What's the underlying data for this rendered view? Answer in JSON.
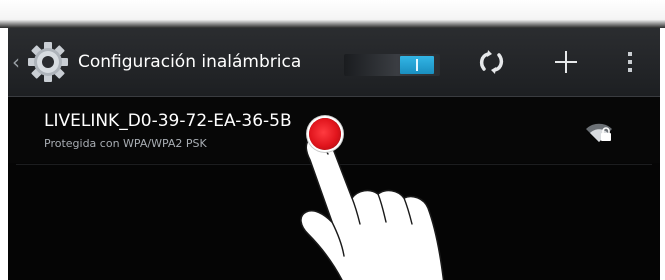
{
  "action_bar": {
    "title": "Configuración inalámbrica",
    "up_icon": "chevron-left-icon",
    "app_icon": "settings-gear-icon",
    "wifi_toggle": {
      "state": "on",
      "accent": "#33b5e5"
    },
    "actions": [
      {
        "name": "wps-icon"
      },
      {
        "name": "add-network-icon"
      },
      {
        "name": "overflow-menu-icon"
      }
    ]
  },
  "networks": [
    {
      "ssid": "LIVELINK_D0-39-72-EA-36-5B",
      "security": "Protegida con WPA/WPA2 PSK",
      "signal_icon": "wifi-locked-icon"
    }
  ],
  "touch_indicator": {
    "color": "#e0141c"
  },
  "colors": {
    "screen_background": "#050505",
    "action_bar": "#24262a",
    "title_text": "#ffffff",
    "secondary_text": "#a8adb3",
    "accent": "#33b5e5"
  }
}
